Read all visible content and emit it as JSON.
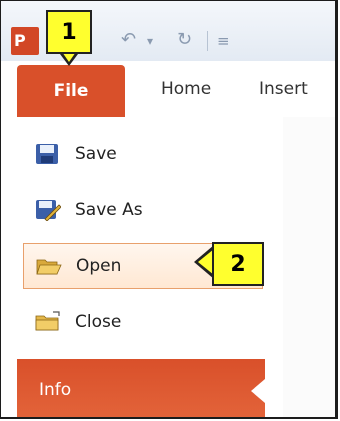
{
  "quick_access": {
    "app_icon": "powerpoint-icon",
    "undo_icon": "undo-icon",
    "redo_icon": "redo-icon",
    "customize_icon": "customize-qat-icon"
  },
  "ribbon": {
    "tabs": [
      {
        "label": "File",
        "active": true
      },
      {
        "label": "Home"
      },
      {
        "label": "Insert"
      }
    ]
  },
  "backstage": {
    "items": [
      {
        "label": "Save",
        "icon": "save-icon"
      },
      {
        "label": "Save As",
        "icon": "save-as-icon"
      },
      {
        "label": "Open",
        "icon": "open-folder-icon",
        "selected": true
      },
      {
        "label": "Close",
        "icon": "close-folder-icon"
      },
      {
        "label": "Info",
        "active": true
      }
    ]
  },
  "callouts": [
    {
      "label": "1"
    },
    {
      "label": "2"
    }
  ],
  "colors": {
    "file_tab": "#d9502a",
    "highlight": "#ffff2e",
    "selected_border": "#e8a06c"
  }
}
